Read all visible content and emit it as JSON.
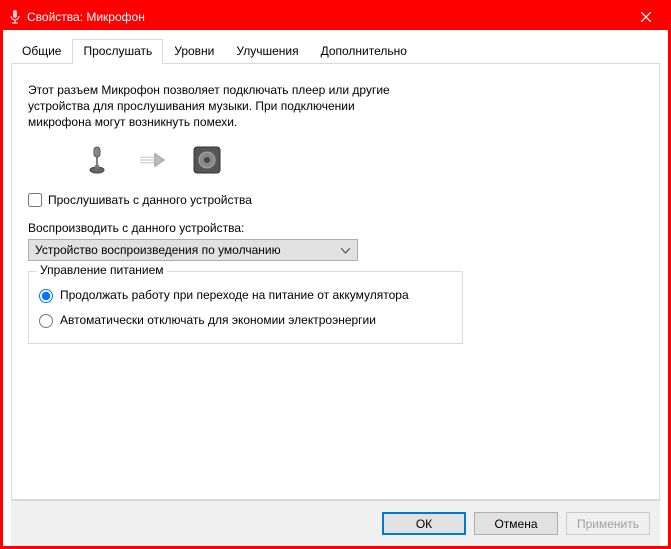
{
  "window": {
    "title": "Свойства: Микрофон"
  },
  "tabs": {
    "general": "Общие",
    "listen": "Прослушать",
    "levels": "Уровни",
    "enhancements": "Улучшения",
    "advanced": "Дополнительно"
  },
  "listen_tab": {
    "description": "Этот разъем Микрофон позволяет подключать плеер или другие устройства для прослушивания музыки. При подключении микрофона могут возникнуть помехи.",
    "listen_checkbox_label": "Прослушивать с данного устройства",
    "playback_label": "Воспроизводить с данного устройства:",
    "playback_selected": "Устройство воспроизведения по умолчанию",
    "power_group_legend": "Управление питанием",
    "radio_continue": "Продолжать работу при переходе на питание от аккумулятора",
    "radio_auto_off": "Автоматически отключать для экономии электроэнергии"
  },
  "buttons": {
    "ok": "ОК",
    "cancel": "Отмена",
    "apply": "Применить"
  }
}
